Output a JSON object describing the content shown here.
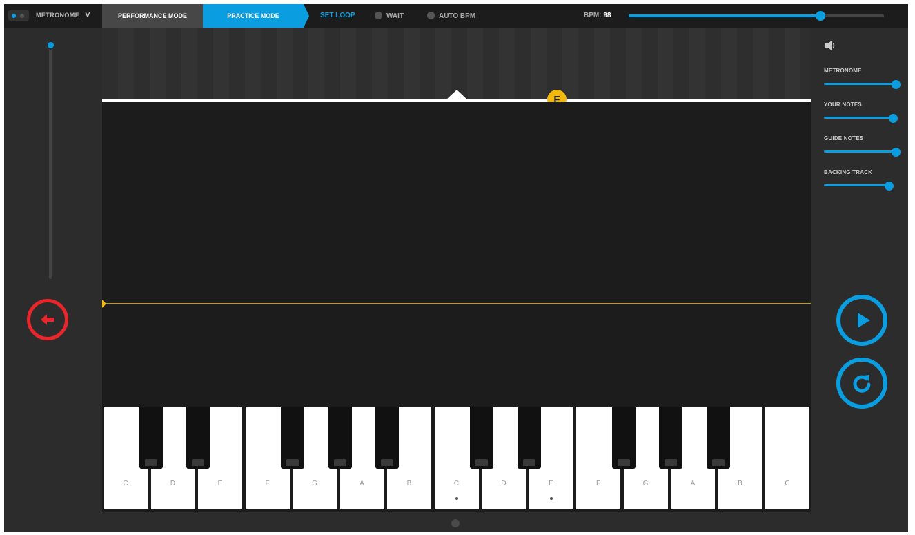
{
  "topbar": {
    "metronome_label": "METRONOME",
    "performance_mode": "PERFORMANCE MODE",
    "practice_mode": "PRACTICE MODE",
    "set_loop": "SET LOOP",
    "wait": "WAIT",
    "auto_bpm": "AUTO BPM",
    "bpm_label": "BPM:",
    "bpm_value": "98",
    "bpm_slider_fraction": 0.75
  },
  "stage": {
    "note_badge": "F"
  },
  "keyboard": {
    "white_keys": [
      "C",
      "D",
      "E",
      "F",
      "G",
      "A",
      "B",
      "C",
      "D",
      "E",
      "F",
      "G",
      "A",
      "B",
      "C"
    ],
    "dotted_keys": [
      7,
      9
    ]
  },
  "mixer": {
    "items": [
      {
        "label": "METRONOME",
        "level": 1.0
      },
      {
        "label": "YOUR NOTES",
        "level": 0.96
      },
      {
        "label": "GUIDE NOTES",
        "level": 1.0
      },
      {
        "label": "BACKING TRACK",
        "level": 0.9
      }
    ]
  },
  "colors": {
    "accent": "#0a9ee0",
    "back_button": "#e8262b",
    "note_highlight": "#f2b90c"
  },
  "icons": {
    "back": "arrow-left-icon",
    "play": "play-icon",
    "restart": "restart-icon",
    "volume": "speaker-icon",
    "dropdown": "chevron-down-icon"
  }
}
